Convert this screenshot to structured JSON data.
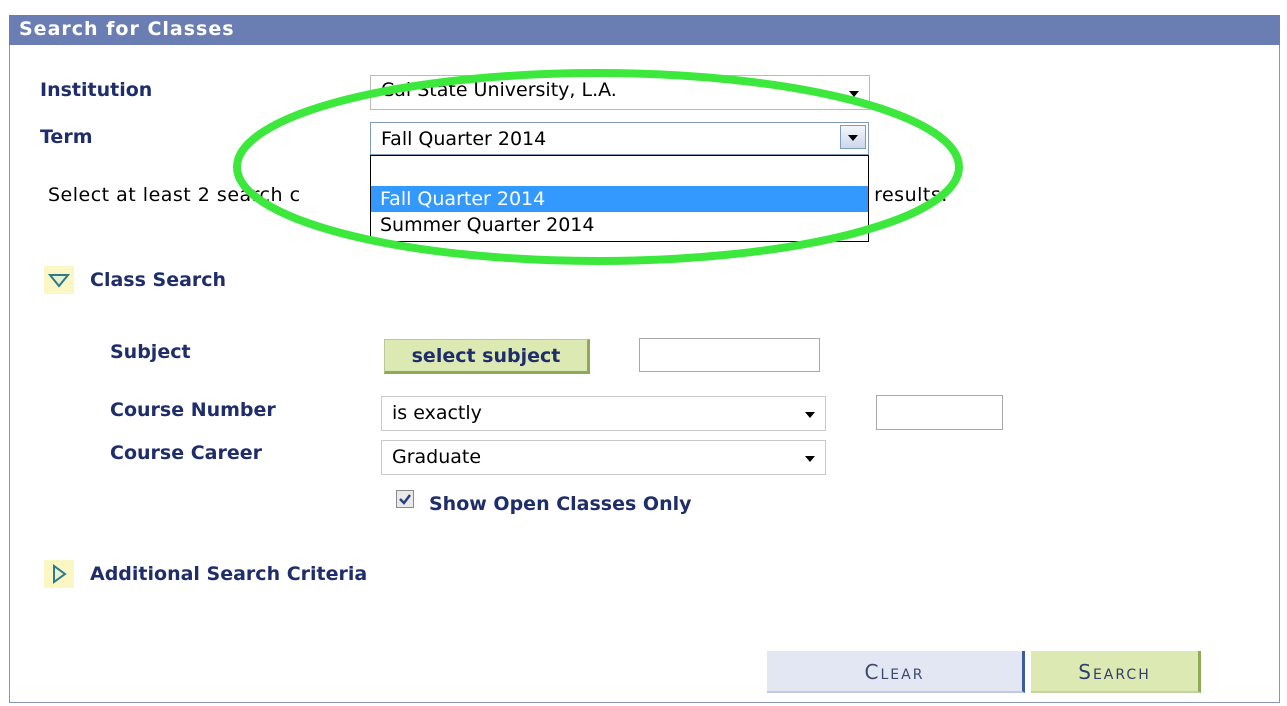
{
  "page": {
    "title": "Search for Classes"
  },
  "institution": {
    "label": "Institution",
    "value": "Cal State University, L.A."
  },
  "term": {
    "label": "Term",
    "value": "Fall Quarter 2014",
    "options": [
      "",
      "Fall Quarter 2014",
      "Summer Quarter 2014"
    ],
    "selected_option": "Fall Quarter 2014"
  },
  "message": {
    "start": "Select at least 2 search c",
    "end": "h results."
  },
  "class_search": {
    "section_label": "Class Search",
    "subject": {
      "label": "Subject",
      "button_label": "select subject",
      "value": ""
    },
    "course_number": {
      "label": "Course Number",
      "operator": "is exactly",
      "value": ""
    },
    "course_career": {
      "label": "Course Career",
      "value": "Graduate"
    },
    "open_only": {
      "label": "Show Open Classes Only",
      "checked": true
    }
  },
  "additional": {
    "section_label": "Additional Search Criteria"
  },
  "buttons": {
    "clear": "Clear",
    "search": "Search"
  },
  "colors": {
    "header": "#6b7eb3",
    "label": "#1f2d6b",
    "highlight_oval": "#3de83d",
    "selected_option": "#3399ff",
    "button_green": "#dde9b2"
  }
}
